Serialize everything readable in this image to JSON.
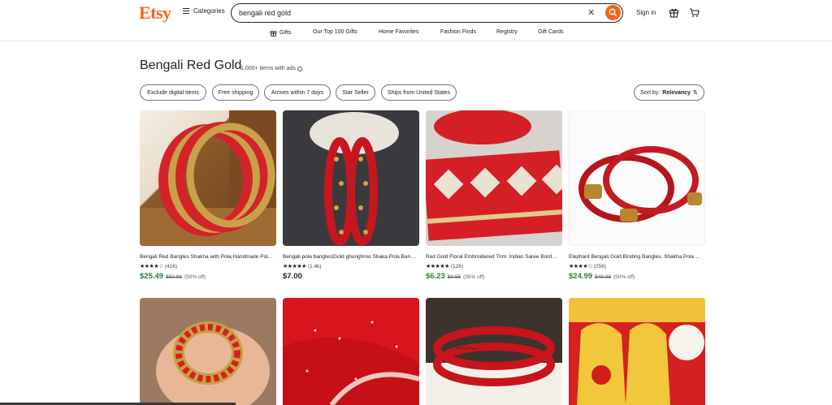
{
  "header": {
    "logo": "Etsy",
    "categories_label": "Categories",
    "search_value": "bengali red gold",
    "signin_label": "Sign in"
  },
  "nav": {
    "items": [
      "Gifts",
      "Our Top 100 Gifts",
      "Home Favorites",
      "Fashion Finds",
      "Registry",
      "Gift Cards"
    ]
  },
  "page": {
    "title": "Bengali Red Gold",
    "count": "1,000+ items with ads"
  },
  "filters": [
    "Exclude digital items",
    "Free shipping",
    "Arrives within 7 days",
    "Star Seller",
    "Ships from United States"
  ],
  "sort": {
    "label": "Sort by:",
    "value": "Relevancy"
  },
  "products": [
    {
      "name": "Bengali Red Bangles Shakha with Pola,Handmade Pola,Shakha Pola...",
      "reviews": "(416)",
      "price": "$25.49",
      "original": "$50.98",
      "discount": "(50% off)",
      "on_sale": true,
      "stars": 4.5
    },
    {
      "name": "Bengali pola bangles|Gold ghunghroo Shaka Pola Bangles|Sakha...",
      "reviews": "(1.4k)",
      "price": "$7.00",
      "original": "",
      "discount": "",
      "on_sale": false,
      "stars": 5
    },
    {
      "name": "Red Gold Floral Embroidered Trim: Indian Saree Border...",
      "reviews": "(126)",
      "price": "$6.23",
      "original": "$9.58",
      "discount": "(35% off)",
      "on_sale": true,
      "stars": 5
    },
    {
      "name": "Elephant Bengali Gold Binding Bangles, Shakha Pola Bangles...",
      "reviews": "(256)",
      "price": "$24.99",
      "original": "$49.98",
      "discount": "(50% off)",
      "on_sale": true,
      "stars": 4.5
    }
  ],
  "row2_caption": "Abhushnam",
  "colors": {
    "brand": "#f1641e",
    "sale_green": "#258635",
    "text": "#222222"
  }
}
